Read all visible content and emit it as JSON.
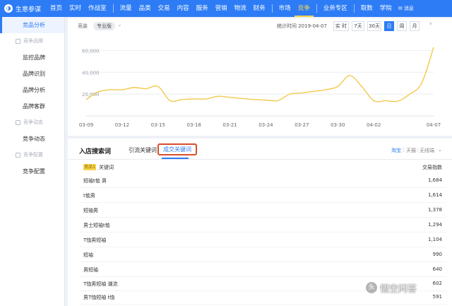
{
  "app": {
    "logo_glyph": "◑",
    "title": "生意参谋"
  },
  "nav": {
    "items": [
      "首页",
      "实时",
      "作战室",
      "流量",
      "品类",
      "交易",
      "内容",
      "服务",
      "营销",
      "物流",
      "财务",
      "市场",
      "竞争",
      "业务专区",
      "取数",
      "学院"
    ],
    "active": "竞争",
    "mail": "消息"
  },
  "sidebar": {
    "active_item": "竞品分析",
    "group1": "竞争品牌",
    "group1_items": [
      "监控品牌",
      "品牌识别",
      "品牌分析",
      "品牌客群"
    ],
    "group2": "竞争动态",
    "group2_items": [
      "竞争动态"
    ],
    "group3": "竞争配置",
    "group3_items": [
      "竞争配置"
    ]
  },
  "toolbar": {
    "label": "竞装",
    "version": "专业版",
    "stat_time": "统计时间 2019-04-07",
    "buttons": [
      "实 时",
      "7天",
      "30天",
      "日",
      "周",
      "月"
    ],
    "active_button": "日",
    "more_icon": "chevron-right"
  },
  "chart_data": {
    "type": "line",
    "x": [
      "03-09",
      "03-10",
      "03-11",
      "03-12",
      "03-13",
      "03-14",
      "03-15",
      "03-16",
      "03-17",
      "03-18",
      "03-19",
      "03-20",
      "03-21",
      "03-22",
      "03-23",
      "03-24",
      "03-25",
      "03-26",
      "03-27",
      "03-28",
      "03-29",
      "03-30",
      "03-31",
      "04-01",
      "04-02",
      "04-03",
      "04-04",
      "04-05",
      "04-06",
      "04-07"
    ],
    "xticks": [
      "03-09",
      "03-12",
      "03-15",
      "03-18",
      "03-21",
      "03-24",
      "03-27",
      "03-30",
      "04-02",
      "04-07"
    ],
    "y": [
      15000,
      22000,
      24000,
      24000,
      26000,
      25000,
      27000,
      14000,
      15000,
      15500,
      15500,
      18000,
      17000,
      16000,
      15000,
      14500,
      14000,
      20000,
      21000,
      22500,
      24000,
      27000,
      37000,
      27000,
      14000,
      14000,
      13500,
      20000,
      30000,
      63000
    ],
    "yticks": [
      20000,
      40000,
      60000
    ],
    "ytick_labels": [
      "20,000",
      "40,000",
      "60,000"
    ],
    "ylim": [
      0,
      70000
    ],
    "grid": true,
    "color": "#f2c94c"
  },
  "lower": {
    "title": "入店搜索词",
    "tab1": "引流关键词",
    "tab2": "成交关键词",
    "sources": [
      "淘宝",
      "天猫",
      "无线端"
    ],
    "active_source": "淘宝",
    "rank_badge": "竞品1",
    "col_keyword": "关键词",
    "col_index": "交易指数",
    "rows": [
      {
        "kw": "短袖t恤 男",
        "val": "1,684"
      },
      {
        "kw": "t恤男",
        "val": "1,614"
      },
      {
        "kw": "短袖男",
        "val": "1,378"
      },
      {
        "kw": "男士短袖t恤",
        "val": "1,294"
      },
      {
        "kw": "T恤男短袖",
        "val": "1,104"
      },
      {
        "kw": "短袖",
        "val": "990"
      },
      {
        "kw": "男短袖",
        "val": "640"
      },
      {
        "kw": "T恤男短袖 潮流",
        "val": "602"
      },
      {
        "kw": "男T恤短袖 t恤",
        "val": "591"
      }
    ]
  },
  "watermark": {
    "icon": "头",
    "text": "悟空问答"
  }
}
